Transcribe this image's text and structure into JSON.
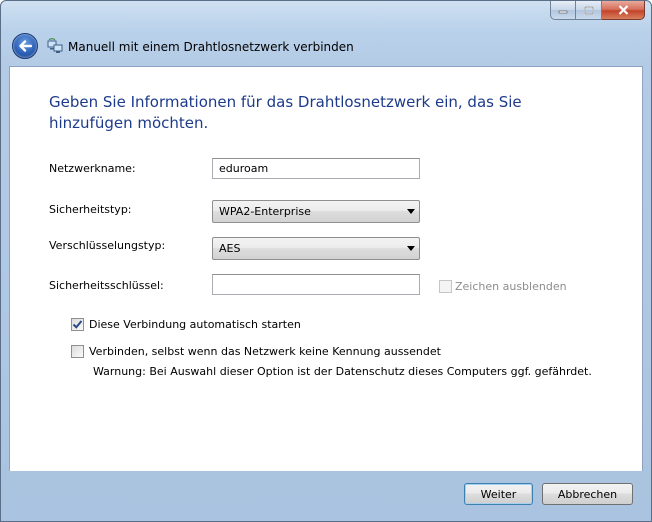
{
  "window": {
    "title": "Manuell mit einem Drahtlosnetzwerk verbinden"
  },
  "heading": "Geben Sie Informationen für das Drahtlosnetzwerk ein, das Sie hinzufügen möchten.",
  "form": {
    "network_name_label": "Netzwerkname:",
    "network_name_value": "eduroam",
    "security_type_label": "Sicherheitstyp:",
    "security_type_value": "WPA2-Enterprise",
    "encryption_type_label": "Verschlüsselungstyp:",
    "encryption_type_value": "AES",
    "security_key_label": "Sicherheitsschlüssel:",
    "security_key_value": "",
    "hide_chars_label": "Zeichen ausblenden"
  },
  "options": {
    "auto_start_label": "Diese Verbindung automatisch starten",
    "auto_start_checked": true,
    "connect_hidden_label": "Verbinden, selbst wenn das Netzwerk keine Kennung aussendet",
    "connect_hidden_checked": false,
    "warning_text": "Warnung: Bei Auswahl dieser Option ist der Datenschutz dieses Computers ggf. gefährdet."
  },
  "buttons": {
    "next_label": "Weiter",
    "cancel_label": "Abbrechen"
  },
  "colors": {
    "heading": "#1e3b8b",
    "frame": "#b9d1ea",
    "close_button": "#c4432b"
  },
  "icons": {
    "back": "back-arrow-icon",
    "wizard": "wireless-network-icon",
    "minimize": "minimize-icon",
    "maximize": "maximize-icon",
    "close": "close-icon",
    "dropdown": "chevron-down-icon",
    "check": "checkmark-icon"
  }
}
